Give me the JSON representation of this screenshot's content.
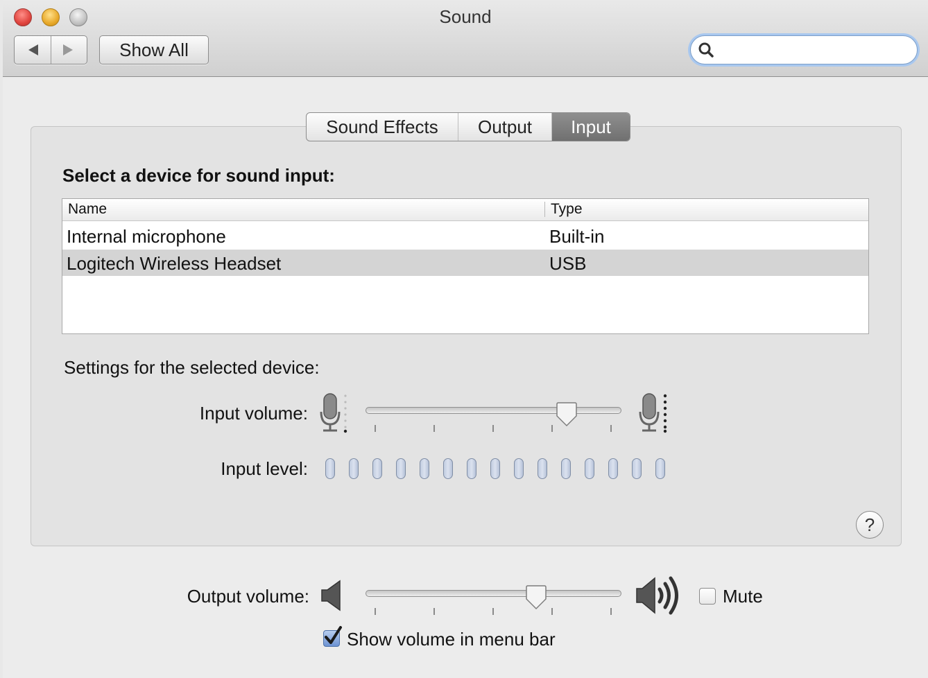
{
  "window": {
    "title": "Sound"
  },
  "toolbar": {
    "show_all_label": "Show All",
    "search_placeholder": ""
  },
  "tabs": [
    {
      "label": "Sound Effects",
      "active": false
    },
    {
      "label": "Output",
      "active": false
    },
    {
      "label": "Input",
      "active": true
    }
  ],
  "input": {
    "heading": "Select a device for sound input:",
    "table": {
      "columns": [
        "Name",
        "Type"
      ],
      "rows": [
        {
          "name": "Internal microphone",
          "type": "Built-in",
          "selected": false
        },
        {
          "name": "Logitech Wireless Headset",
          "type": "USB",
          "selected": true
        }
      ]
    },
    "settings_heading": "Settings for the selected device:",
    "input_volume_label": "Input volume:",
    "input_volume_value": 0.79,
    "input_level_label": "Input level:",
    "input_level_segments": 15,
    "input_level_active": 0
  },
  "output": {
    "volume_label": "Output volume:",
    "volume_value": 0.67,
    "mute_label": "Mute",
    "mute_checked": false,
    "show_volume_label": "Show volume in menu bar",
    "show_volume_checked": true
  },
  "help_label": "?",
  "colors": {
    "selected_row": "#d4d4d4",
    "active_tab": "#7b7b7b",
    "search_focus": "#a9c8ef"
  },
  "icons": [
    "back-arrow-icon",
    "forward-arrow-icon",
    "search-icon",
    "mic-low-icon",
    "mic-high-icon",
    "speaker-low-icon",
    "speaker-high-icon",
    "help-icon",
    "checkmark-icon"
  ]
}
